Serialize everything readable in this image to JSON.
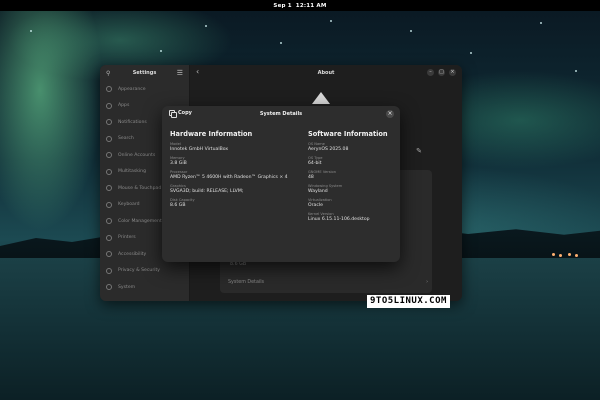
{
  "topbar": {
    "date": "Sep 1",
    "time": "12:11 AM"
  },
  "settings": {
    "sidebar": {
      "title": "Settings",
      "search_icon": "search-icon",
      "menu_icon": "hamburger-icon",
      "items": [
        {
          "label": "Appearance",
          "icon": "palette-icon"
        },
        {
          "label": "Apps",
          "icon": "apps-icon"
        },
        {
          "label": "Notifications",
          "icon": "bell-icon"
        },
        {
          "label": "Search",
          "icon": "search-icon"
        },
        {
          "label": "Online Accounts",
          "icon": "cloud-icon"
        },
        {
          "label": "Multitasking",
          "icon": "multitasking-icon"
        },
        {
          "label": "Mouse & Touchpad",
          "icon": "mouse-icon"
        },
        {
          "label": "Keyboard",
          "icon": "keyboard-icon"
        },
        {
          "label": "Color Management",
          "icon": "color-icon"
        },
        {
          "label": "Printers",
          "icon": "printer-icon"
        },
        {
          "label": "Accessibility",
          "icon": "accessibility-icon"
        },
        {
          "label": "Privacy & Security",
          "icon": "shield-icon"
        },
        {
          "label": "System",
          "icon": "system-icon"
        }
      ]
    },
    "main": {
      "title": "About",
      "disk_value": "8.6 GB",
      "system_details_label": "System Details"
    }
  },
  "dialog": {
    "title": "System Details",
    "copy_label": "Copy",
    "hardware": {
      "heading": "Hardware Information",
      "fields": [
        {
          "label": "Model",
          "value": "Innotek GmbH VirtualBox"
        },
        {
          "label": "Memory",
          "value": "3.8 GiB"
        },
        {
          "label": "Processor",
          "value": "AMD Ryzen™ 5 4600H with Radeon™ Graphics × 4"
        },
        {
          "label": "Graphics",
          "value": "SVGA3D; build: RELEASE; LLVM;"
        },
        {
          "label": "Disk Capacity",
          "value": "8.6 GB"
        }
      ]
    },
    "software": {
      "heading": "Software Information",
      "fields": [
        {
          "label": "OS Name",
          "value": "AerynOS 2025.08"
        },
        {
          "label": "OS Type",
          "value": "64-bit"
        },
        {
          "label": "GNOME Version",
          "value": "48"
        },
        {
          "label": "Windowing System",
          "value": "Wayland"
        },
        {
          "label": "Virtualization",
          "value": "Oracle"
        },
        {
          "label": "Kernel Version",
          "value": "Linux 6.15.11-106.desktop"
        }
      ]
    }
  },
  "watermark": "9TO5LINUX.COM"
}
